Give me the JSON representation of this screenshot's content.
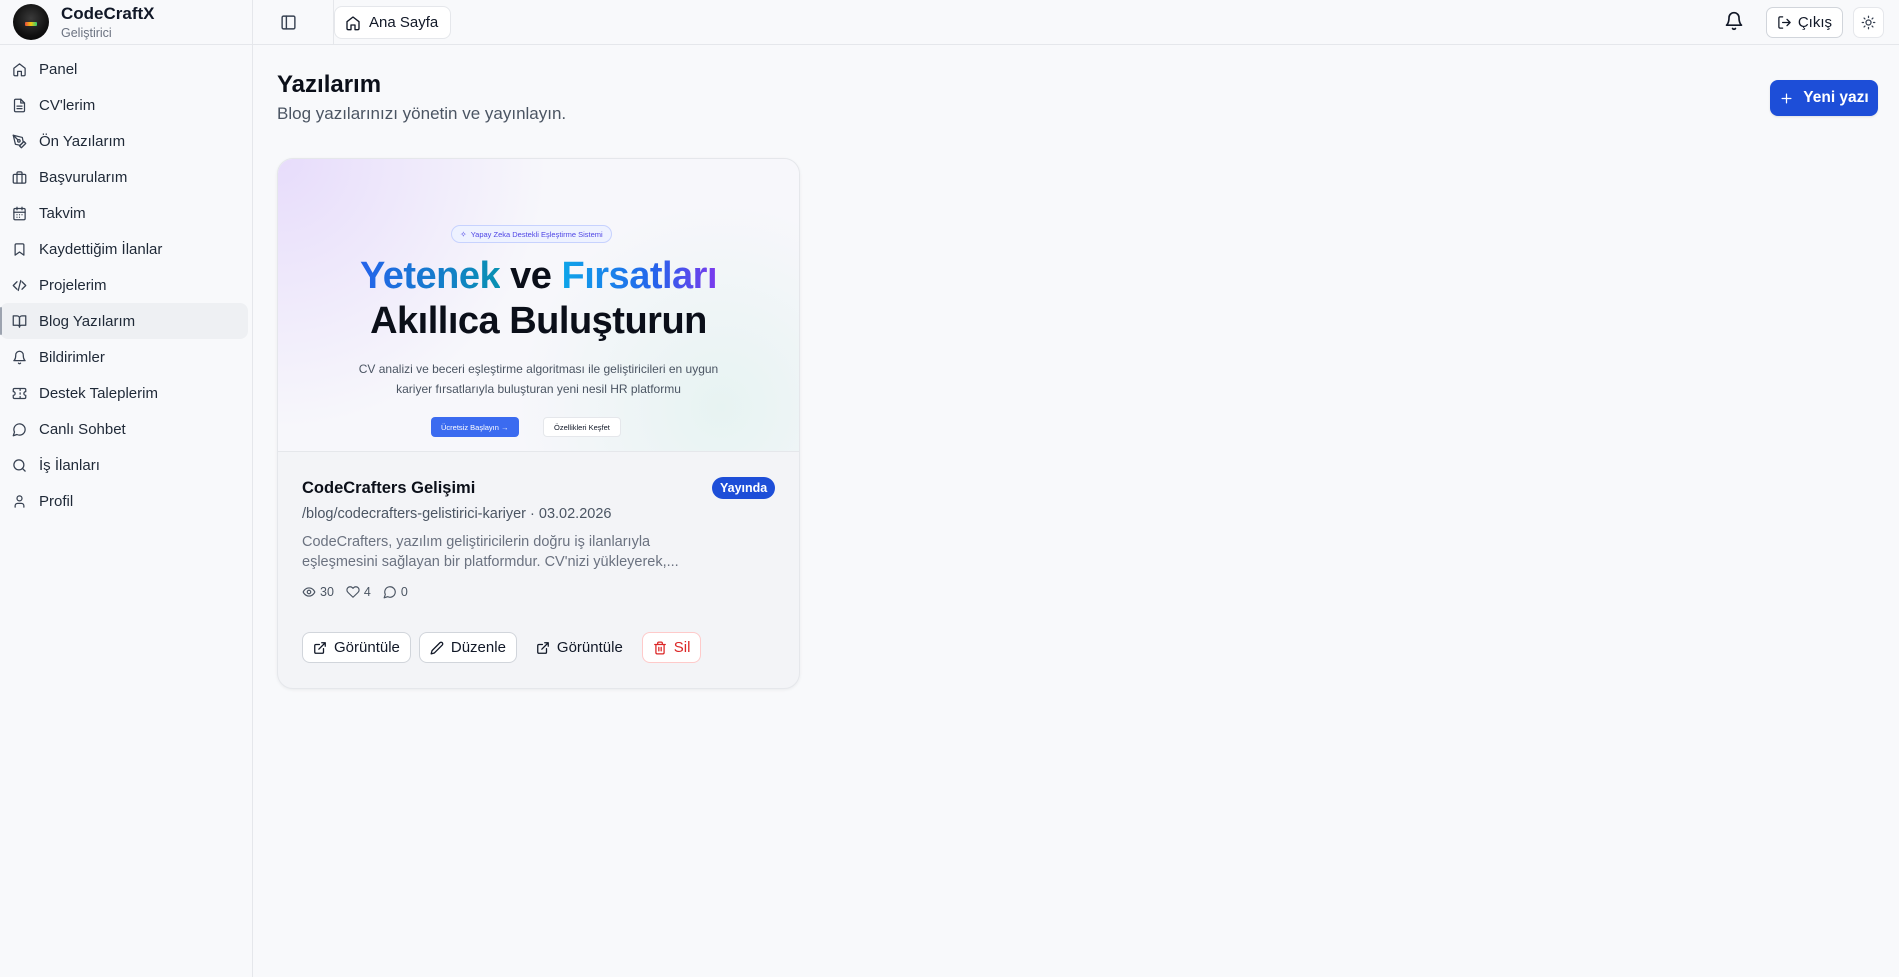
{
  "brand": {
    "name": "CodeCraftX",
    "role": "Geliştirici"
  },
  "sidebar": {
    "items": [
      {
        "label": "Panel",
        "icon": "home-icon"
      },
      {
        "label": "CV'lerim",
        "icon": "file-icon"
      },
      {
        "label": "Ön Yazılarım",
        "icon": "pen-tool-icon"
      },
      {
        "label": "Başvurularım",
        "icon": "briefcase-icon"
      },
      {
        "label": "Takvim",
        "icon": "calendar-icon"
      },
      {
        "label": "Kaydettiğim İlanlar",
        "icon": "bookmark-icon"
      },
      {
        "label": "Projelerim",
        "icon": "code-icon"
      },
      {
        "label": "Blog Yazılarım",
        "icon": "book-open-icon",
        "active": true
      },
      {
        "label": "Bildirimler",
        "icon": "bell-icon"
      },
      {
        "label": "Destek Taleplerim",
        "icon": "ticket-icon"
      },
      {
        "label": "Canlı Sohbet",
        "icon": "message-circle-icon"
      },
      {
        "label": "İş İlanları",
        "icon": "search-icon"
      },
      {
        "label": "Profil",
        "icon": "user-icon"
      }
    ]
  },
  "header": {
    "home_label": "Ana Sayfa",
    "logout_label": "Çıkış"
  },
  "main": {
    "title": "Yazılarım",
    "subtitle": "Blog yazılarınızı yönetin ve yayınlayın.",
    "new_button": "Yeni yazı"
  },
  "post": {
    "cover": {
      "badge": "Yapay Zeka Destekli Eşleştirme Sistemi",
      "h1_word1": "Yetenek",
      "h1_mid": " ve ",
      "h1_word2": "Fırsatları",
      "h1_line2": "Akıllıca Buluşturun",
      "desc_line1": "CV analizi ve beceri eşleştirme algoritması ile geliştiricileri en uygun",
      "desc_line2": "kariyer fırsatlarıyla buluşturan yeni nesil HR platformu",
      "cta_primary": "Ücretsiz Başlayın →",
      "cta_secondary": "Özellikleri Keşfet"
    },
    "title": "CodeCrafters Gelişimi",
    "status": "Yayında",
    "slug_date": "/blog/codecrafters-gelistirici-kariyer · 03.02.2026",
    "excerpt_line1": "CodeCrafters, yazılım geliştiricilerin doğru iş ilanlarıyla",
    "excerpt_line2": "eşleşmesini sağlayan bir platformdur. CV'nizi yükleyerek,...",
    "stats": {
      "views": "30",
      "likes": "4",
      "comments": "0"
    },
    "actions": {
      "view1": "Görüntüle",
      "edit": "Düzenle",
      "view2": "Görüntüle",
      "delete": "Sil"
    }
  },
  "colors": {
    "primary": "#1d4ed8",
    "danger": "#dc2626"
  }
}
